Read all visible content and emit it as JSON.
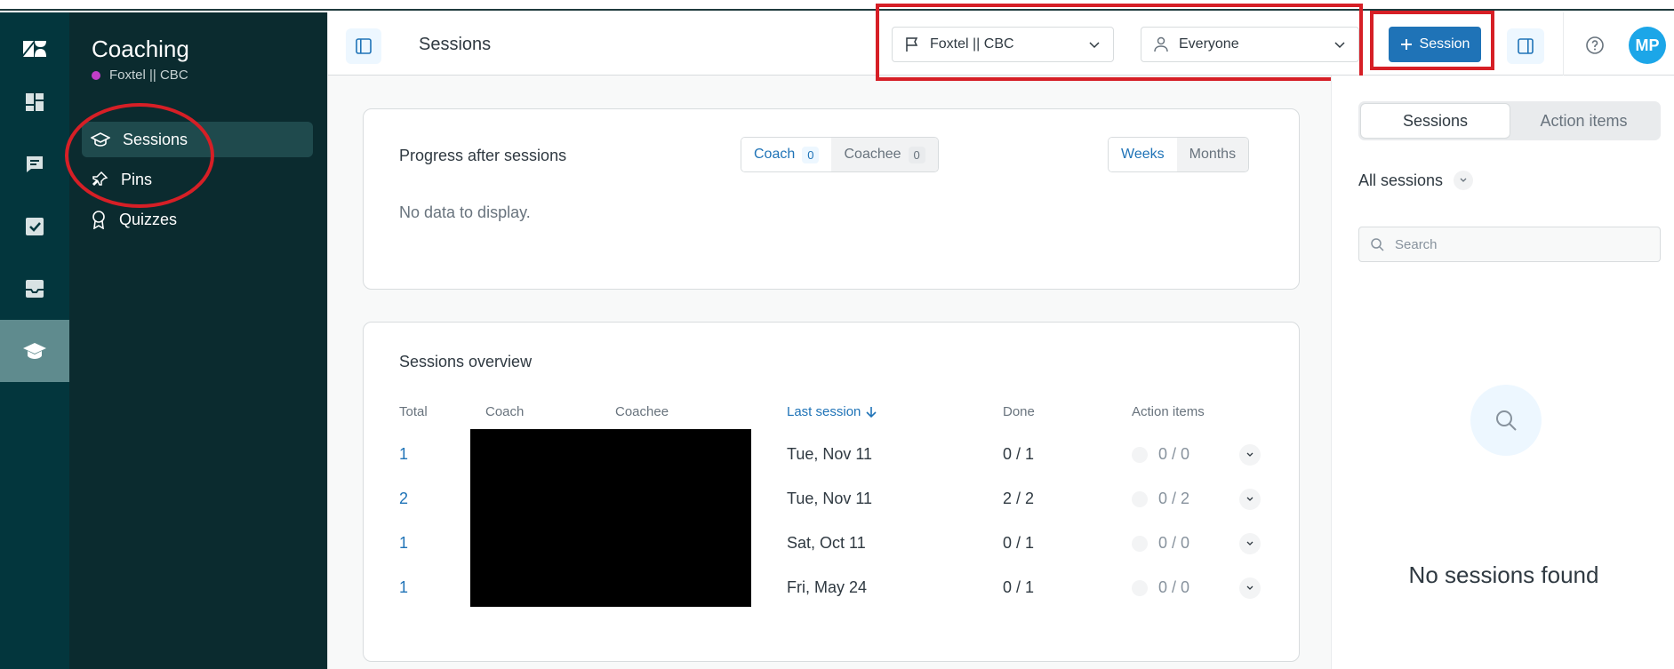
{
  "rail": {
    "icons": [
      "zendesk-logo-icon",
      "dashboard-icon",
      "chat-icon",
      "check-square-icon",
      "inbox-icon",
      "graduation-cap-icon"
    ],
    "active_index": 5
  },
  "nav": {
    "title": "Coaching",
    "subtitle": "Foxtel || CBC",
    "items": [
      {
        "label": "Sessions",
        "icon": "graduation-cap-icon",
        "active": true
      },
      {
        "label": "Pins",
        "icon": "pin-icon",
        "active": false
      },
      {
        "label": "Quizzes",
        "icon": "award-icon",
        "active": false
      }
    ]
  },
  "header": {
    "title": "Sessions",
    "team_filter": "Foxtel || CBC",
    "people_filter": "Everyone",
    "new_session_label": "Session",
    "avatar_initials": "MP"
  },
  "progress": {
    "title": "Progress after sessions",
    "role_tabs": [
      {
        "label": "Coach",
        "count": "0",
        "active": true
      },
      {
        "label": "Coachee",
        "count": "0",
        "active": false
      }
    ],
    "period_tabs": [
      {
        "label": "Weeks",
        "active": true
      },
      {
        "label": "Months",
        "active": false
      }
    ],
    "empty_text": "No data to display."
  },
  "overview": {
    "title": "Sessions overview",
    "columns": {
      "total": "Total",
      "coach": "Coach",
      "coachee": "Coachee",
      "last_session": "Last session",
      "done": "Done",
      "action_items": "Action items"
    },
    "rows": [
      {
        "total": "1",
        "last_session": "Tue, Nov 11",
        "done": "0 / 1",
        "action_items": "0 / 0"
      },
      {
        "total": "2",
        "last_session": "Tue, Nov 11",
        "done": "2 / 2",
        "action_items": "0 / 2"
      },
      {
        "total": "1",
        "last_session": "Sat, Oct 11",
        "done": "0 / 1",
        "action_items": "0 / 0"
      },
      {
        "total": "1",
        "last_session": "Fri, May 24",
        "done": "0 / 1",
        "action_items": "0 / 0"
      }
    ]
  },
  "right_panel": {
    "tabs": [
      {
        "label": "Sessions",
        "active": true
      },
      {
        "label": "Action items",
        "active": false
      }
    ],
    "filter_label": "All sessions",
    "search_placeholder": "Search",
    "empty_text": "No sessions found"
  },
  "colors": {
    "accent": "#1f73b7",
    "rail": "#03363d",
    "nav": "#0b2b2f",
    "annotation": "#d61f26"
  }
}
